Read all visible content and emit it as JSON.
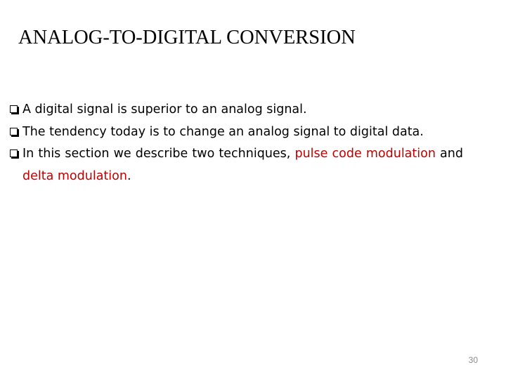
{
  "slide": {
    "title": "ANALOG-TO-DIGITAL CONVERSION",
    "bullets": [
      {
        "segments": [
          {
            "text": "A digital signal is superior to an analog signal.",
            "color": "#000000"
          }
        ]
      },
      {
        "segments": [
          {
            "text": "The tendency today is to change an analog signal to digital data.",
            "color": "#000000"
          }
        ]
      },
      {
        "segments": [
          {
            "text": "In this section we describe two techniques, ",
            "color": "#000000"
          },
          {
            "text": "pulse code modulation",
            "color": "#c00000"
          },
          {
            "text": " and ",
            "color": "#000000"
          },
          {
            "text": "delta modulation",
            "color": "#c00000"
          },
          {
            "text": ".",
            "color": "#000000"
          }
        ]
      }
    ],
    "bullet_icon": "checkbox-square-icon",
    "page_number": "30"
  }
}
